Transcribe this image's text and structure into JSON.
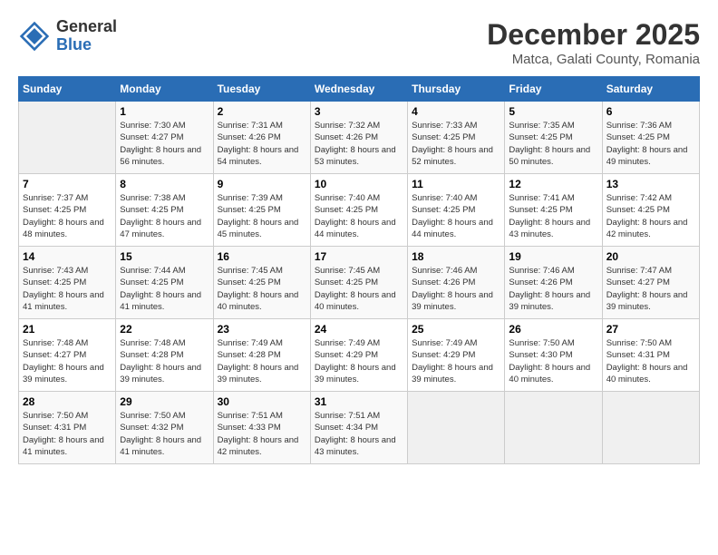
{
  "logo": {
    "general": "General",
    "blue": "Blue"
  },
  "title": "December 2025",
  "subtitle": "Matca, Galati County, Romania",
  "header_days": [
    "Sunday",
    "Monday",
    "Tuesday",
    "Wednesday",
    "Thursday",
    "Friday",
    "Saturday"
  ],
  "weeks": [
    [
      {
        "day": "",
        "sunrise": "",
        "sunset": "",
        "daylight": ""
      },
      {
        "day": "1",
        "sunrise": "Sunrise: 7:30 AM",
        "sunset": "Sunset: 4:27 PM",
        "daylight": "Daylight: 8 hours and 56 minutes."
      },
      {
        "day": "2",
        "sunrise": "Sunrise: 7:31 AM",
        "sunset": "Sunset: 4:26 PM",
        "daylight": "Daylight: 8 hours and 54 minutes."
      },
      {
        "day": "3",
        "sunrise": "Sunrise: 7:32 AM",
        "sunset": "Sunset: 4:26 PM",
        "daylight": "Daylight: 8 hours and 53 minutes."
      },
      {
        "day": "4",
        "sunrise": "Sunrise: 7:33 AM",
        "sunset": "Sunset: 4:25 PM",
        "daylight": "Daylight: 8 hours and 52 minutes."
      },
      {
        "day": "5",
        "sunrise": "Sunrise: 7:35 AM",
        "sunset": "Sunset: 4:25 PM",
        "daylight": "Daylight: 8 hours and 50 minutes."
      },
      {
        "day": "6",
        "sunrise": "Sunrise: 7:36 AM",
        "sunset": "Sunset: 4:25 PM",
        "daylight": "Daylight: 8 hours and 49 minutes."
      }
    ],
    [
      {
        "day": "7",
        "sunrise": "Sunrise: 7:37 AM",
        "sunset": "Sunset: 4:25 PM",
        "daylight": "Daylight: 8 hours and 48 minutes."
      },
      {
        "day": "8",
        "sunrise": "Sunrise: 7:38 AM",
        "sunset": "Sunset: 4:25 PM",
        "daylight": "Daylight: 8 hours and 47 minutes."
      },
      {
        "day": "9",
        "sunrise": "Sunrise: 7:39 AM",
        "sunset": "Sunset: 4:25 PM",
        "daylight": "Daylight: 8 hours and 45 minutes."
      },
      {
        "day": "10",
        "sunrise": "Sunrise: 7:40 AM",
        "sunset": "Sunset: 4:25 PM",
        "daylight": "Daylight: 8 hours and 44 minutes."
      },
      {
        "day": "11",
        "sunrise": "Sunrise: 7:40 AM",
        "sunset": "Sunset: 4:25 PM",
        "daylight": "Daylight: 8 hours and 44 minutes."
      },
      {
        "day": "12",
        "sunrise": "Sunrise: 7:41 AM",
        "sunset": "Sunset: 4:25 PM",
        "daylight": "Daylight: 8 hours and 43 minutes."
      },
      {
        "day": "13",
        "sunrise": "Sunrise: 7:42 AM",
        "sunset": "Sunset: 4:25 PM",
        "daylight": "Daylight: 8 hours and 42 minutes."
      }
    ],
    [
      {
        "day": "14",
        "sunrise": "Sunrise: 7:43 AM",
        "sunset": "Sunset: 4:25 PM",
        "daylight": "Daylight: 8 hours and 41 minutes."
      },
      {
        "day": "15",
        "sunrise": "Sunrise: 7:44 AM",
        "sunset": "Sunset: 4:25 PM",
        "daylight": "Daylight: 8 hours and 41 minutes."
      },
      {
        "day": "16",
        "sunrise": "Sunrise: 7:45 AM",
        "sunset": "Sunset: 4:25 PM",
        "daylight": "Daylight: 8 hours and 40 minutes."
      },
      {
        "day": "17",
        "sunrise": "Sunrise: 7:45 AM",
        "sunset": "Sunset: 4:25 PM",
        "daylight": "Daylight: 8 hours and 40 minutes."
      },
      {
        "day": "18",
        "sunrise": "Sunrise: 7:46 AM",
        "sunset": "Sunset: 4:26 PM",
        "daylight": "Daylight: 8 hours and 39 minutes."
      },
      {
        "day": "19",
        "sunrise": "Sunrise: 7:46 AM",
        "sunset": "Sunset: 4:26 PM",
        "daylight": "Daylight: 8 hours and 39 minutes."
      },
      {
        "day": "20",
        "sunrise": "Sunrise: 7:47 AM",
        "sunset": "Sunset: 4:27 PM",
        "daylight": "Daylight: 8 hours and 39 minutes."
      }
    ],
    [
      {
        "day": "21",
        "sunrise": "Sunrise: 7:48 AM",
        "sunset": "Sunset: 4:27 PM",
        "daylight": "Daylight: 8 hours and 39 minutes."
      },
      {
        "day": "22",
        "sunrise": "Sunrise: 7:48 AM",
        "sunset": "Sunset: 4:28 PM",
        "daylight": "Daylight: 8 hours and 39 minutes."
      },
      {
        "day": "23",
        "sunrise": "Sunrise: 7:49 AM",
        "sunset": "Sunset: 4:28 PM",
        "daylight": "Daylight: 8 hours and 39 minutes."
      },
      {
        "day": "24",
        "sunrise": "Sunrise: 7:49 AM",
        "sunset": "Sunset: 4:29 PM",
        "daylight": "Daylight: 8 hours and 39 minutes."
      },
      {
        "day": "25",
        "sunrise": "Sunrise: 7:49 AM",
        "sunset": "Sunset: 4:29 PM",
        "daylight": "Daylight: 8 hours and 39 minutes."
      },
      {
        "day": "26",
        "sunrise": "Sunrise: 7:50 AM",
        "sunset": "Sunset: 4:30 PM",
        "daylight": "Daylight: 8 hours and 40 minutes."
      },
      {
        "day": "27",
        "sunrise": "Sunrise: 7:50 AM",
        "sunset": "Sunset: 4:31 PM",
        "daylight": "Daylight: 8 hours and 40 minutes."
      }
    ],
    [
      {
        "day": "28",
        "sunrise": "Sunrise: 7:50 AM",
        "sunset": "Sunset: 4:31 PM",
        "daylight": "Daylight: 8 hours and 41 minutes."
      },
      {
        "day": "29",
        "sunrise": "Sunrise: 7:50 AM",
        "sunset": "Sunset: 4:32 PM",
        "daylight": "Daylight: 8 hours and 41 minutes."
      },
      {
        "day": "30",
        "sunrise": "Sunrise: 7:51 AM",
        "sunset": "Sunset: 4:33 PM",
        "daylight": "Daylight: 8 hours and 42 minutes."
      },
      {
        "day": "31",
        "sunrise": "Sunrise: 7:51 AM",
        "sunset": "Sunset: 4:34 PM",
        "daylight": "Daylight: 8 hours and 43 minutes."
      },
      {
        "day": "",
        "sunrise": "",
        "sunset": "",
        "daylight": ""
      },
      {
        "day": "",
        "sunrise": "",
        "sunset": "",
        "daylight": ""
      },
      {
        "day": "",
        "sunrise": "",
        "sunset": "",
        "daylight": ""
      }
    ]
  ]
}
